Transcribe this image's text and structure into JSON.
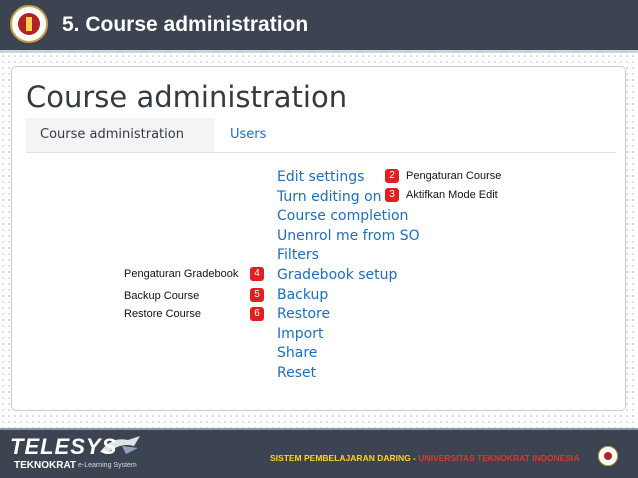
{
  "header": {
    "title": "5. Course administration"
  },
  "card": {
    "heading": "Course administration",
    "tabs": [
      {
        "label": "Course administration",
        "active": true
      },
      {
        "label": "Users",
        "active": false
      }
    ],
    "menu": [
      "Edit settings",
      "Turn editing on",
      "Course completion",
      "Unenrol me from SO",
      "Filters",
      "Gradebook setup",
      "Backup",
      "Restore",
      "Import",
      "Share",
      "Reset"
    ]
  },
  "annotations": [
    {
      "number": "2",
      "text": "Pengaturan Course"
    },
    {
      "number": "3",
      "text": "Aktifkan Mode Edit"
    },
    {
      "number": "4",
      "text": "Pengaturan Gradebook"
    },
    {
      "number": "5",
      "text": "Backup Course"
    },
    {
      "number": "6",
      "text": "Restore Course"
    }
  ],
  "footer": {
    "brand": "TELESYS",
    "brand_sub": "TEKNOKRAT",
    "brand_tag": "e-Learning System",
    "text_part1": "SISTEM PEMBELAJARAN DARING - ",
    "text_part2": "UNIVERSITAS TEKNOKRAT INDONESIA"
  },
  "colors": {
    "header_bg": "#3c4452",
    "link": "#1b6ec2",
    "badge": "#e02020",
    "footer_yellow": "#ffd21f",
    "footer_red": "#d63a2f"
  }
}
